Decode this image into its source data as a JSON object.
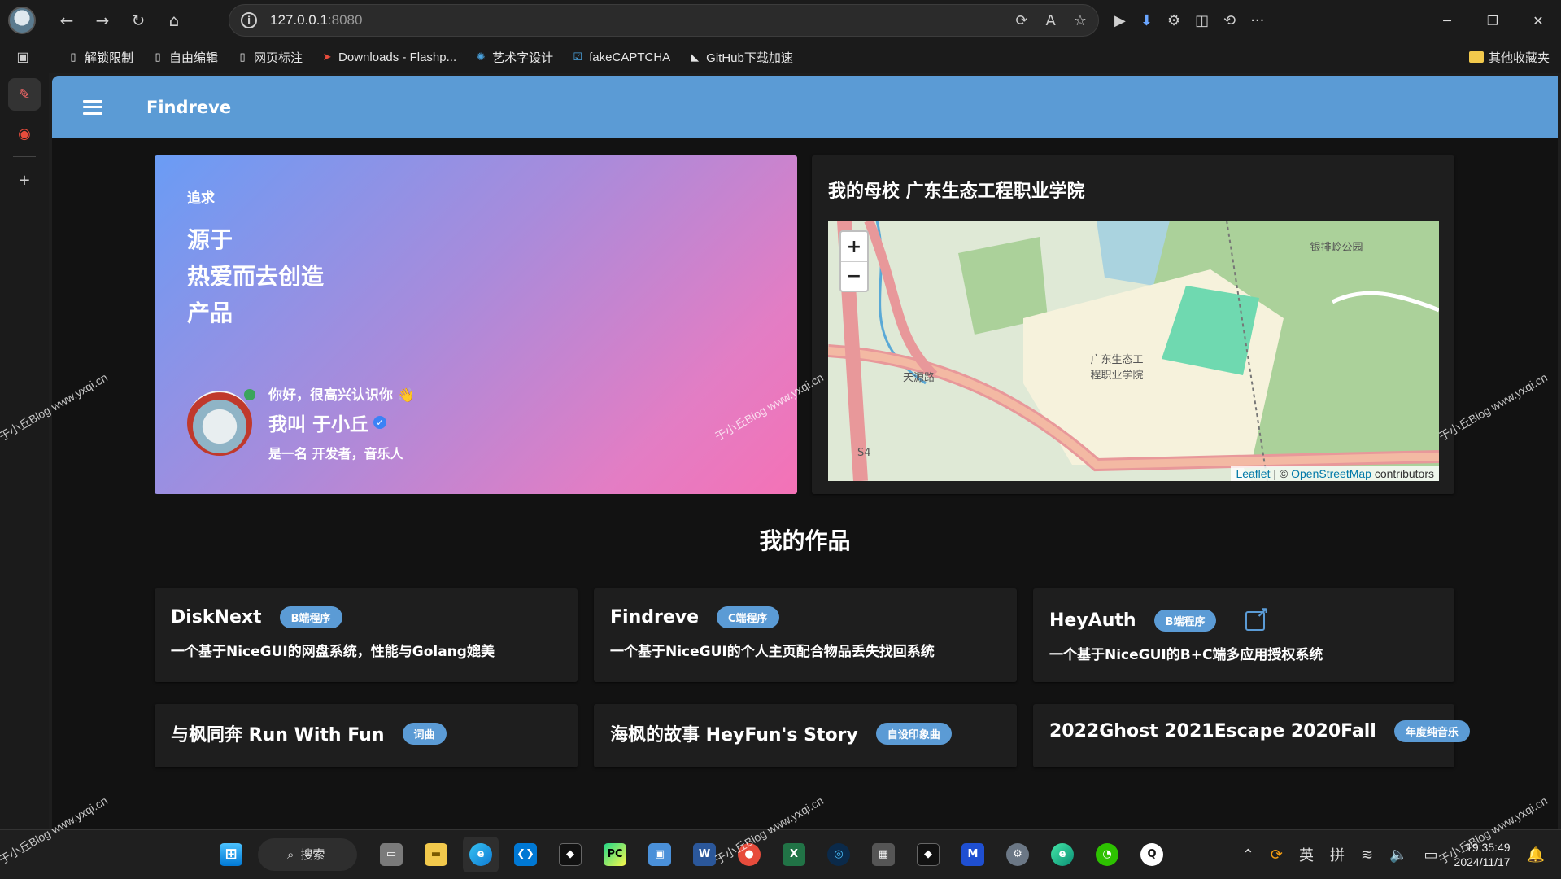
{
  "browser": {
    "url_host": "127.0.0.1",
    "url_port": ":8080",
    "bookmarks": [
      {
        "label": "解锁限制",
        "icon": "page-icon"
      },
      {
        "label": "自由编辑",
        "icon": "page-icon"
      },
      {
        "label": "网页标注",
        "icon": "page-icon"
      },
      {
        "label": "Downloads - Flashp...",
        "icon": "flashpoint-icon"
      },
      {
        "label": "艺术字设计",
        "icon": "design-icon"
      },
      {
        "label": "fakeCAPTCHA",
        "icon": "checkbox-icon"
      },
      {
        "label": "GitHub下载加速",
        "icon": "github-icon"
      }
    ],
    "other_bookmarks": "其他收藏夹"
  },
  "app": {
    "title": "Findreve"
  },
  "hero": {
    "tag": "追求",
    "lines": [
      "源于",
      "热爱而去创造",
      "产品"
    ],
    "greeting": "你好，很高兴认识你 👋",
    "name": "我叫 于小丘",
    "bio": "是一名 开发者，音乐人"
  },
  "school": {
    "title": "我的母校 广东生态工程职业学院",
    "map_labels": [
      "银排岭公园",
      "广东生态工程职业学院",
      "天源路",
      "S4"
    ],
    "attribution_leaflet": "Leaflet",
    "attribution_sep": " | © ",
    "attribution_osm": "OpenStreetMap",
    "attribution_tail": " contributors"
  },
  "works": {
    "title": "我的作品",
    "items": [
      {
        "name": "DiskNext",
        "badge": "B端程序",
        "desc": "一个基于NiceGUI的网盘系统，性能与Golang媲美"
      },
      {
        "name": "Findreve",
        "badge": "C端程序",
        "desc": "一个基于NiceGUI的个人主页配合物品丢失找回系统"
      },
      {
        "name": "HeyAuth",
        "badge": "B端程序",
        "desc": "一个基于NiceGUI的B+C端多应用授权系统"
      },
      {
        "name": "与枫同奔 Run With Fun",
        "badge": "词曲",
        "desc": ""
      },
      {
        "name": "海枫的故事 HeyFun's Story",
        "badge": "自设印象曲",
        "desc": ""
      },
      {
        "name": "2022Ghost 2021Escape 2020Fall",
        "badge": "年度纯音乐",
        "desc": ""
      }
    ]
  },
  "taskbar": {
    "search_label": "搜索",
    "ime_lang": "英",
    "ime_mode": "拼",
    "time": "19:35:49",
    "date": "2024/11/17"
  },
  "watermark": "于小丘Blog www.yxqi.cn",
  "colors": {
    "header": "#5b9bd5",
    "badge": "#5b9bd5",
    "hero_gradient_start": "#6a9cf5",
    "hero_gradient_end": "#f472b6"
  }
}
